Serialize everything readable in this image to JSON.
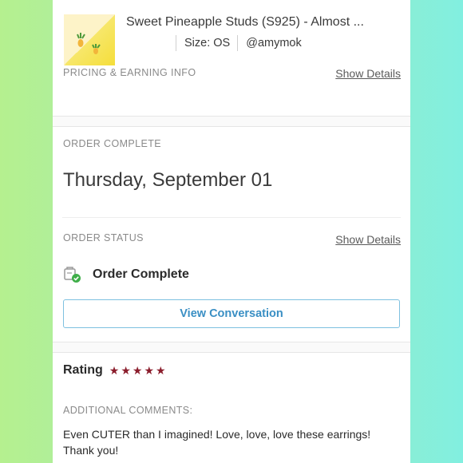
{
  "product": {
    "title": "Sweet Pineapple Studs (S925) - Almost ...",
    "size": "Size: OS",
    "seller": "@amymok"
  },
  "pricing": {
    "label": "PRICING & EARNING INFO",
    "show_details": "Show Details"
  },
  "order_complete": {
    "label": "ORDER COMPLETE",
    "date": "Thursday, September 01"
  },
  "order_status": {
    "label": "ORDER STATUS",
    "show_details": "Show Details",
    "status_text": "Order Complete",
    "status_icon": "order-complete-check-icon"
  },
  "conversation": {
    "button_label": "View Conversation"
  },
  "rating": {
    "label": "Rating",
    "stars": 5,
    "star_glyph": "★",
    "star_color": "#8b1d2c"
  },
  "comments": {
    "label": "ADDITIONAL COMMENTS:",
    "text": "Even CUTER than I imagined! Love, love, love these earrings! Thank you!"
  },
  "colors": {
    "accent_button": "#3a8fc4",
    "status_check": "#3fae49"
  }
}
